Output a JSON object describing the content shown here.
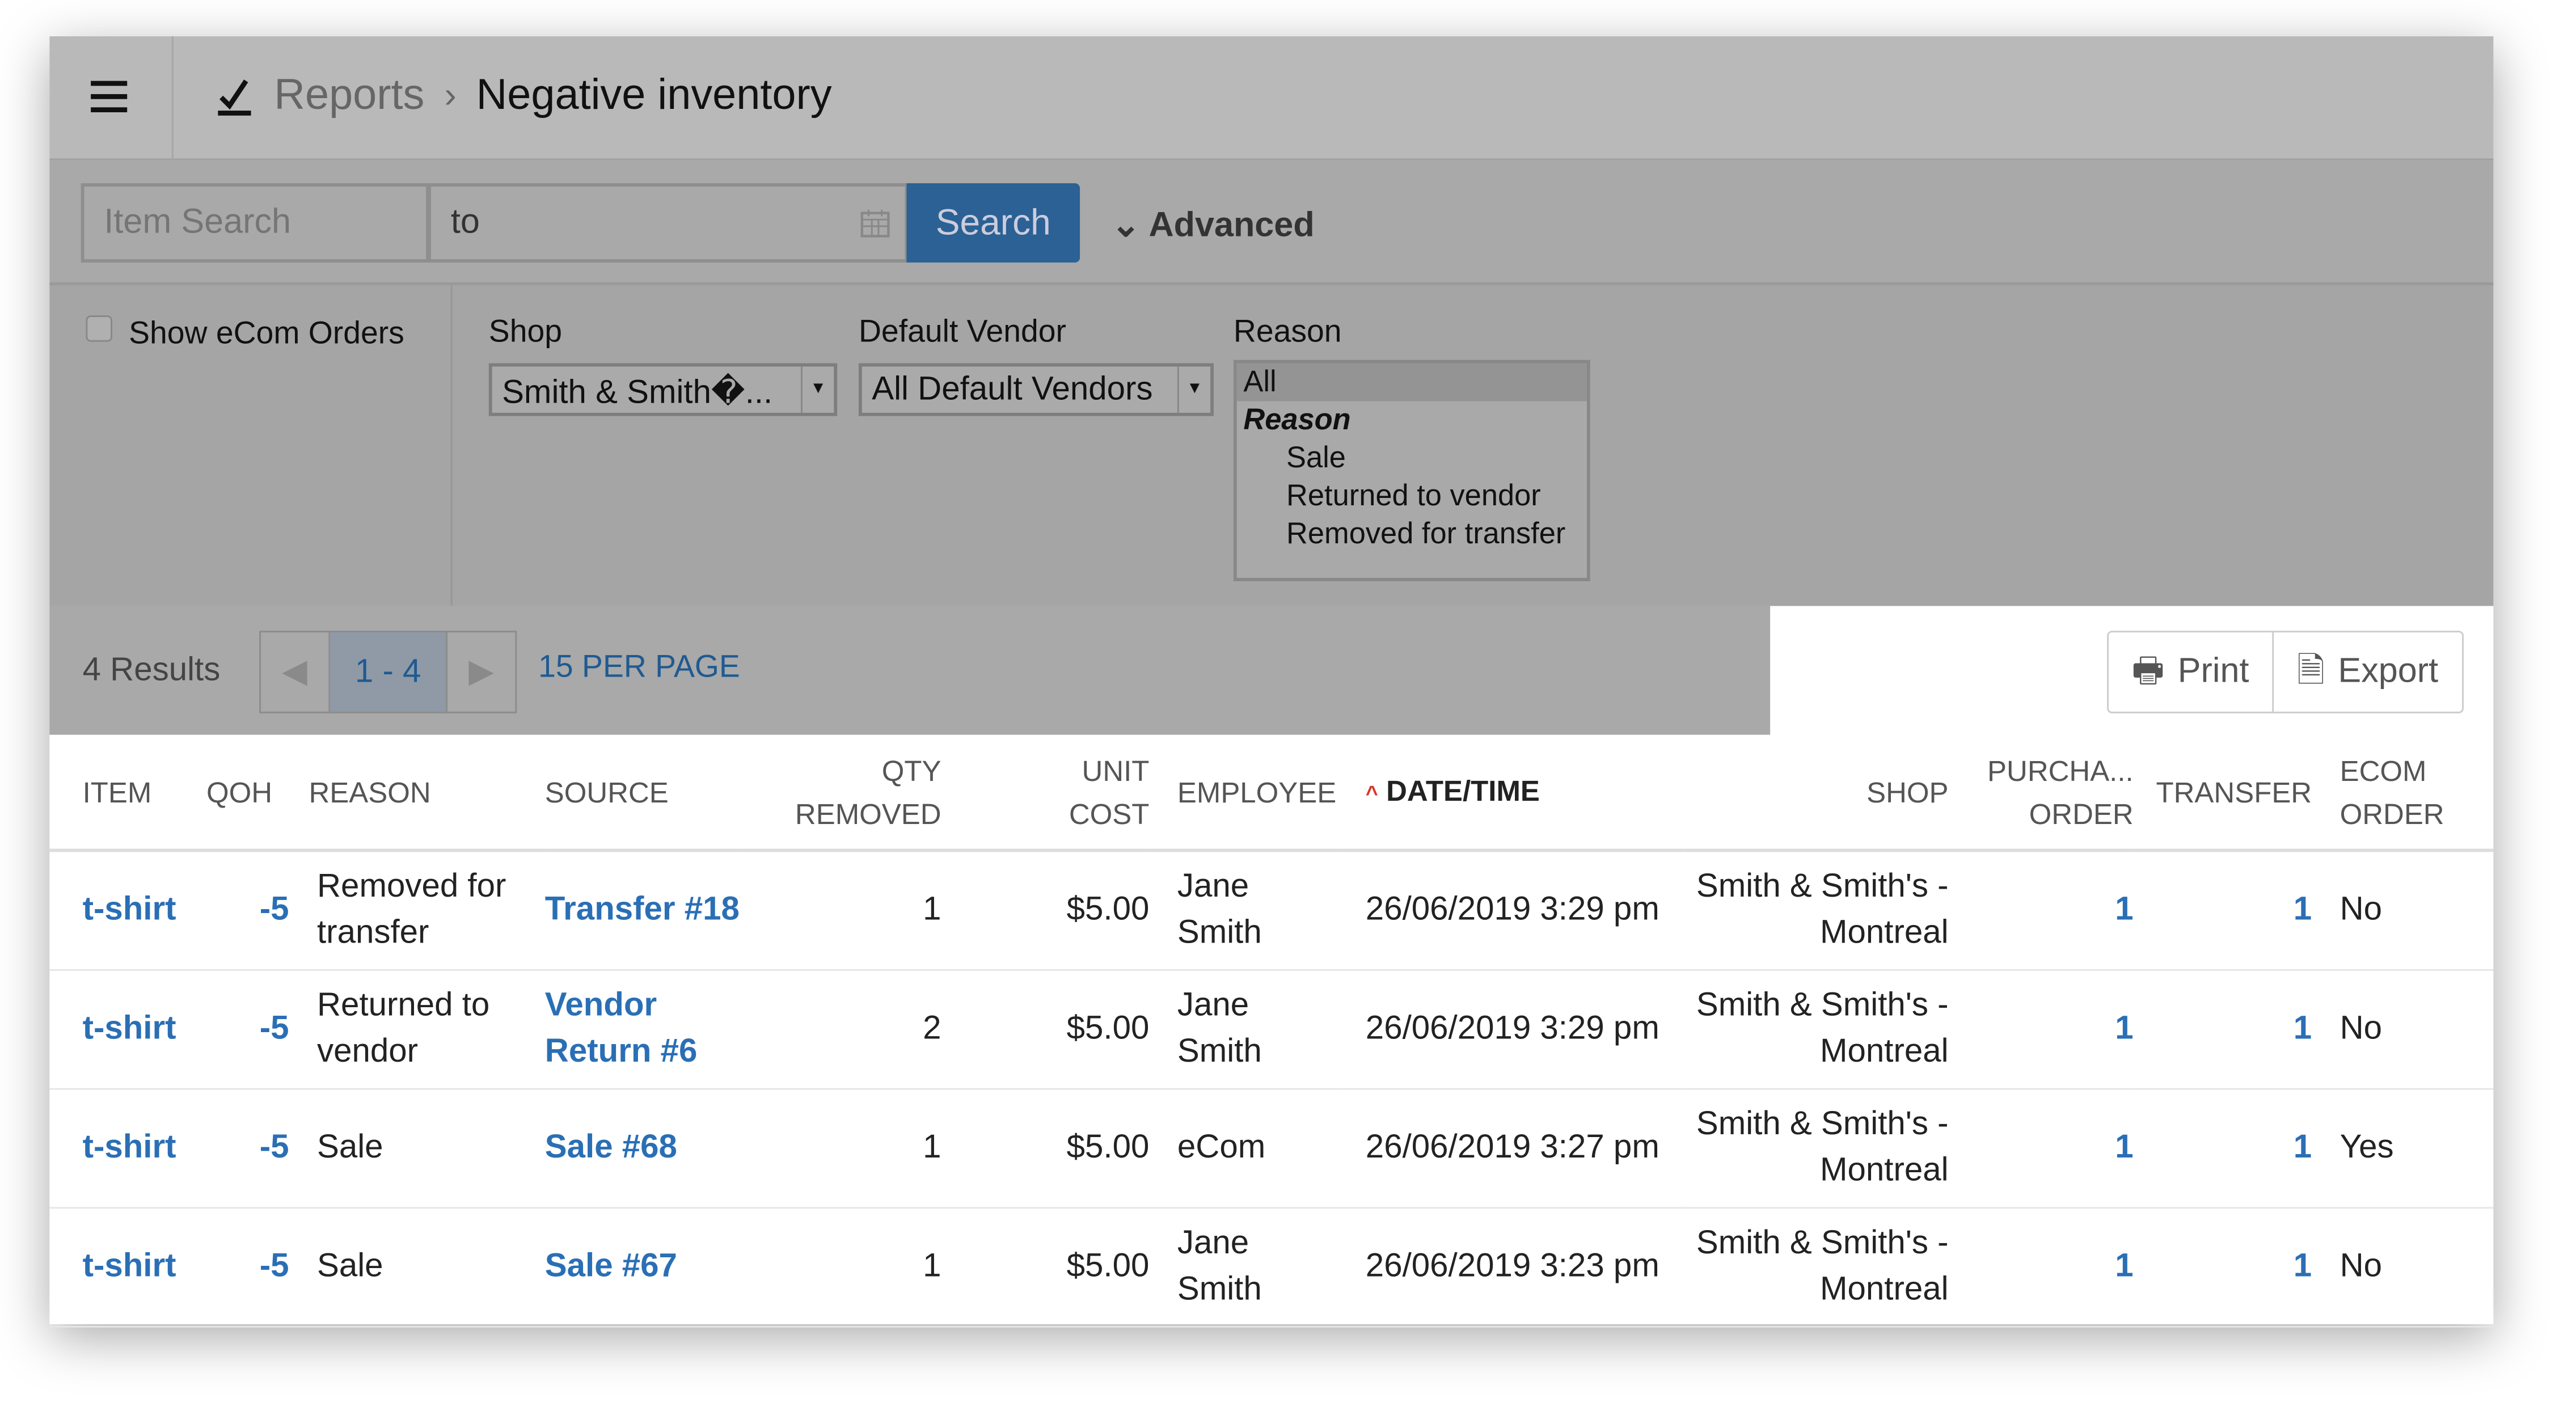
{
  "header": {
    "breadcrumb_parent": "Reports",
    "separator": "›",
    "title": "Negative inventory"
  },
  "toolbar": {
    "item_search_placeholder": "Item Search",
    "date_range_value": "to",
    "search_label": "Search",
    "advanced_label": "Advanced"
  },
  "filters": {
    "show_ecom_label": "Show eCom Orders",
    "show_ecom_checked": false,
    "shop_label": "Shop",
    "shop_value": "Smith & Smith�...",
    "vendor_label": "Default Vendor",
    "vendor_value": "All Default Vendors",
    "reason_label": "Reason",
    "reason_options": {
      "selected": "All",
      "group": "Reason",
      "items": [
        "Sale",
        "Returned to vendor",
        "Removed for transfer"
      ]
    }
  },
  "pagination": {
    "results": "4 Results",
    "range": "1 - 4",
    "per_page": "15 PER PAGE"
  },
  "actions": {
    "print": "Print",
    "export": "Export"
  },
  "colors": {
    "accent": "#2b6194",
    "link": "#2a6fb5",
    "sort_arrow": "#d9342b"
  },
  "table": {
    "columns": [
      "ITEM",
      "QOH",
      "REASON",
      "SOURCE",
      "QTY REMOVED",
      "UNIT COST",
      "EMPLOYEE",
      "DATE/TIME",
      "SHOP",
      "PURCHA... ORDER",
      "TRANSFER",
      "ECOM ORDER"
    ],
    "sorted_column": "DATE/TIME",
    "rows": [
      {
        "item": "t-shirt",
        "qoh": "-5",
        "reason": "Removed for transfer",
        "source": "Transfer #18",
        "qty": "1",
        "cost": "$5.00",
        "employee": "Jane Smith",
        "datetime": "26/06/2019 3:29 pm",
        "shop": "Smith & Smith's - Montreal",
        "po": "1",
        "transfer": "1",
        "ecom": "No"
      },
      {
        "item": "t-shirt",
        "qoh": "-5",
        "reason": "Returned to vendor",
        "source": "Vendor Return #6",
        "qty": "2",
        "cost": "$5.00",
        "employee": "Jane Smith",
        "datetime": "26/06/2019 3:29 pm",
        "shop": "Smith & Smith's - Montreal",
        "po": "1",
        "transfer": "1",
        "ecom": "No"
      },
      {
        "item": "t-shirt",
        "qoh": "-5",
        "reason": "Sale",
        "source": "Sale #68",
        "qty": "1",
        "cost": "$5.00",
        "employee": "eCom",
        "datetime": "26/06/2019 3:27 pm",
        "shop": "Smith & Smith's - Montreal",
        "po": "1",
        "transfer": "1",
        "ecom": "Yes"
      },
      {
        "item": "t-shirt",
        "qoh": "-5",
        "reason": "Sale",
        "source": "Sale #67",
        "qty": "1",
        "cost": "$5.00",
        "employee": "Jane Smith",
        "datetime": "26/06/2019 3:23 pm",
        "shop": "Smith & Smith's - Montreal",
        "po": "1",
        "transfer": "1",
        "ecom": "No"
      }
    ]
  }
}
